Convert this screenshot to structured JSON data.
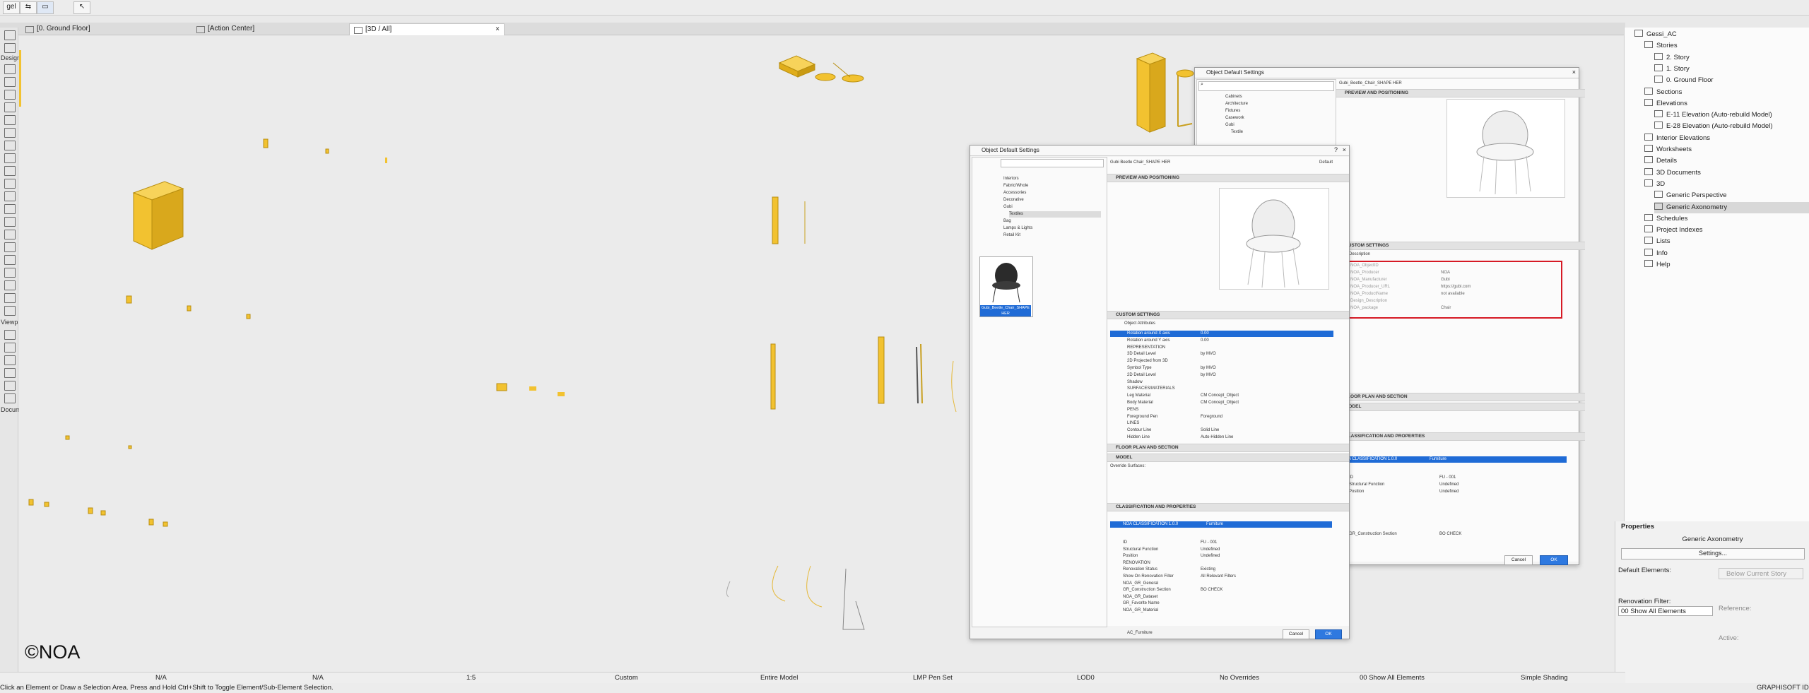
{
  "toolbar": {
    "items": [
      "gel",
      "",
      "",
      ""
    ]
  },
  "tabs": [
    {
      "label": "[0. Ground Floor]"
    },
    {
      "label": "[Action Center]"
    },
    {
      "label": "[3D / All]"
    }
  ],
  "toolbox": {
    "sections": [
      "Design",
      "Viewp",
      "Docum"
    ]
  },
  "canvas": {
    "watermark": "©NOA"
  },
  "statusbar": {
    "items": [
      "N/A",
      "N/A",
      "1:5",
      "Custom",
      "Entire Model",
      "LMP Pen Set",
      "LOD0",
      "No Overrides",
      "00 Show All Elements",
      "Simple Shading"
    ],
    "message": "Click an Element or Draw a Selection Area. Press and Hold Ctrl+Shift to Toggle Element/Sub-Element Selection.",
    "brand": "GRAPHISOFT ID"
  },
  "navigator": {
    "items": [
      {
        "label": "Gessi_AC",
        "level": 0
      },
      {
        "label": "Stories",
        "level": 1
      },
      {
        "label": "2. Story",
        "level": 2
      },
      {
        "label": "1. Story",
        "level": 2
      },
      {
        "label": "0. Ground Floor",
        "level": 2
      },
      {
        "label": "Sections",
        "level": 1
      },
      {
        "label": "Elevations",
        "level": 1
      },
      {
        "label": "E-11 Elevation (Auto-rebuild Model)",
        "level": 2
      },
      {
        "label": "E-28 Elevation (Auto-rebuild Model)",
        "level": 2
      },
      {
        "label": "Interior Elevations",
        "level": 1
      },
      {
        "label": "Worksheets",
        "level": 1
      },
      {
        "label": "Details",
        "level": 1
      },
      {
        "label": "3D Documents",
        "level": 1
      },
      {
        "label": "3D",
        "level": 1
      },
      {
        "label": "Generic Perspective",
        "level": 2
      },
      {
        "label": "Generic Axonometry",
        "level": 2,
        "selected": true
      },
      {
        "label": "Schedules",
        "level": 1
      },
      {
        "label": "Project Indexes",
        "level": 1
      },
      {
        "label": "Lists",
        "level": 1
      },
      {
        "label": "Info",
        "level": 1
      },
      {
        "label": "Help",
        "level": 1
      }
    ]
  },
  "properties": {
    "header": "Properties",
    "name": "Generic Axonometry",
    "settings_button": "Settings...",
    "default_elements": "Default Elements:",
    "renovation_filter_label": "Renovation Filter:",
    "renovation_filter_value": "00 Show All Elements",
    "below_story": "Below Current Story",
    "reference_label": "Reference:",
    "active_label": "Active:"
  },
  "dialog_front": {
    "title": "Object Default Settings",
    "object_name": "Gubi Beetle Chair_SHAPE HER",
    "default_label": "Default",
    "library_items": [
      "Interiors",
      "Fabric/Whole",
      "Accessories",
      "Decorative",
      "Gubi",
      "Textiles",
      "Bag",
      "Lamps & Lights",
      "Retail Kit"
    ],
    "thumb_label": "Gubi_Beetle_Chair_SHAPE HER",
    "sections": {
      "preview": "PREVIEW AND POSITIONING",
      "custom": "CUSTOM SETTINGS",
      "floor_plan": "FLOOR PLAN AND SECTION",
      "model": "MODEL",
      "classification": "CLASSIFICATION AND PROPERTIES"
    },
    "object_attributes": "Object Attributes",
    "param_rows": [
      {
        "name": "Rotation around X axis",
        "value": "0.00",
        "selected": true
      },
      {
        "name": "Rotation around Y axis",
        "value": "0.00"
      },
      {
        "name": "REPRESENTATION",
        "value": ""
      },
      {
        "name": "3D Detail Level",
        "value": "by MVO"
      },
      {
        "name": "2D Projected from 3D",
        "value": ""
      },
      {
        "name": "Symbol Type",
        "value": "by MVO"
      },
      {
        "name": "2D Detail Level",
        "value": "by MVO"
      },
      {
        "name": "Shadow",
        "value": ""
      },
      {
        "name": "SURFACES/MATERIALS",
        "value": ""
      },
      {
        "name": "Leg Material",
        "value": "CM Concept_Object"
      },
      {
        "name": "Body Material",
        "value": "CM Concept_Object"
      },
      {
        "name": "PENS",
        "value": ""
      },
      {
        "name": "Foreground Pen",
        "value": "Foreground"
      },
      {
        "name": "LINES",
        "value": ""
      },
      {
        "name": "Contour Line",
        "value": "Solid Line"
      },
      {
        "name": "Hidden Line",
        "value": "Auto-Hidden Line"
      }
    ],
    "override_surfaces": "Override Surfaces:",
    "classification_row": "NOA CLASSIFICATION 1.0.0",
    "classification_value": "Furniture",
    "class_rows": [
      {
        "name": "ID",
        "value": "FU - 001"
      },
      {
        "name": "Structural Function",
        "value": "Undefined"
      },
      {
        "name": "Position",
        "value": "Undefined"
      },
      {
        "name": "RENOVATION",
        "value": ""
      },
      {
        "name": "Renovation Status",
        "value": "Existing"
      },
      {
        "name": "Show On Renovation Filter",
        "value": "All Relevant Filters"
      },
      {
        "name": "NOA_GR_General",
        "value": ""
      },
      {
        "name": "GR_Construction Section",
        "value": "BO CHECK"
      },
      {
        "name": "NOA_GR_Dataset",
        "value": ""
      },
      {
        "name": "GR_Favorite Name",
        "value": ""
      },
      {
        "name": "NOA_GR_Material",
        "value": ""
      }
    ],
    "layer_value": "AC_Furniture",
    "cancel": "Cancel",
    "ok": "OK"
  },
  "dialog_back": {
    "title": "Object Default Settings",
    "object_name": "Gubi_Beetle_Chair_SHAPE HER",
    "library_items": [
      "Cabinets",
      "Architecture",
      "Fixtures",
      "Casework",
      "Gubi",
      "Textile"
    ],
    "sections": {
      "preview": "PREVIEW AND POSITIONING",
      "custom": "CUSTOM SETTINGS",
      "floor_plan": "FLOOR PLAN AND SECTION",
      "model": "MODEL",
      "classification": "CLASSIFICATION AND PROPERTIES"
    },
    "description_label": "Description",
    "highlight_rows": [
      {
        "name": "NOA_ObjectID",
        "value": ""
      },
      {
        "name": "NOA_Producer",
        "value": "NOA"
      },
      {
        "name": "NOA_Manufacturer",
        "value": "Gubi"
      },
      {
        "name": "NOA_Producer_URL",
        "value": "https://gubi.com"
      },
      {
        "name": "NOA_ProductName",
        "value": "not available"
      },
      {
        "name": "Design_Description",
        "value": ""
      },
      {
        "name": "NOA_package",
        "value": "Chair"
      }
    ],
    "classification_row": "NOA CLASSIFICATION 1.0.0",
    "classification_value": "Furniture",
    "class_rows": [
      {
        "name": "ID",
        "value": "FU - 001"
      },
      {
        "name": "Structural Function",
        "value": "Undefined"
      },
      {
        "name": "Position",
        "value": "Undefined"
      },
      {
        "name": "GR_Construction Section",
        "value": "BO CHECK"
      }
    ],
    "cancel": "Cancel",
    "ok": "OK"
  },
  "colors": {
    "object_yellow": "#f2c230",
    "selection_blue": "#1f6bd6",
    "highlight_red": "#d61a25"
  }
}
